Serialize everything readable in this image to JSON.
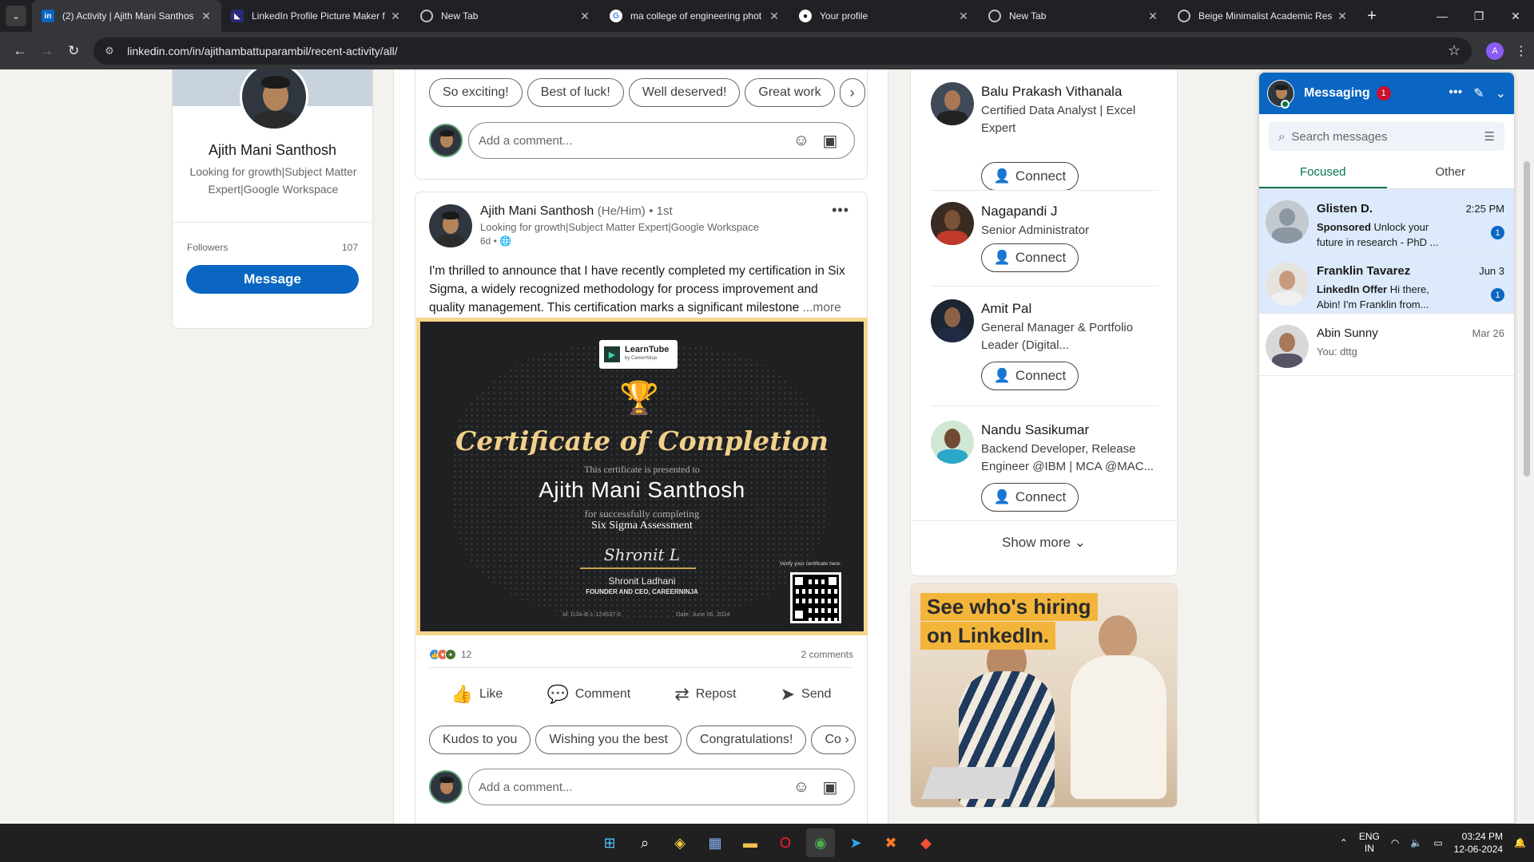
{
  "browser": {
    "tabs": [
      {
        "title": "(2) Activity | Ajith Mani Santhos",
        "favicon": "linkedin-icon",
        "active": true
      },
      {
        "title": "LinkedIn Profile Picture Maker f",
        "favicon": "pfp-maker-icon",
        "active": false
      },
      {
        "title": "New Tab",
        "favicon": "chrome-icon",
        "active": false
      },
      {
        "title": "ma college of engineering phot",
        "favicon": "google-icon",
        "active": false
      },
      {
        "title": "Your profile",
        "favicon": "github-icon",
        "active": false
      },
      {
        "title": "New Tab",
        "favicon": "chrome-icon",
        "active": false
      },
      {
        "title": "Beige Minimalist Academic Res",
        "favicon": "chrome-icon",
        "active": false
      }
    ],
    "url": "linkedin.com/in/ajithambattuparambil/recent-activity/all/",
    "profile_initial": "A"
  },
  "profile_card": {
    "name": "Ajith Mani Santhosh",
    "headline": "Looking for growth|Subject Matter Expert|Google Workspace",
    "followers_label": "Followers",
    "followers_count": "107",
    "message_button": "Message"
  },
  "post1": {
    "chips": [
      "So exciting!",
      "Best of luck!",
      "Well deserved!",
      "Great work"
    ],
    "comment_placeholder": "Add a comment..."
  },
  "post2": {
    "author": "Ajith Mani Santhosh",
    "pronouns": "(He/Him)",
    "degree": "• 1st",
    "headline": "Looking for growth|Subject Matter Expert|Google Workspace",
    "time": "6d •",
    "text": "I'm thrilled to announce that I have recently completed my certification in Six Sigma, a widely recognized methodology for process improvement and quality management. This certification marks a significant milestone",
    "more": "...more",
    "certificate": {
      "brand": "LearnTube",
      "brand_sub": "by CareerNinja",
      "title": "Certificate of Completion",
      "presented": "This certificate is presented to",
      "recipient": "Ajith Mani Santhosh",
      "for_text": "for successfully completing",
      "course": "Six Sigma Assessment",
      "signature": "Shronit L",
      "signer": "Shronit Ladhani",
      "signer_role": "FOUNDER AND CEO, CAREERNINJA",
      "id": "Id: DJA-B-1-124537-0",
      "date": "Date: June 06, 2024",
      "verify": "Verify your certificate here:"
    },
    "reaction_count": "12",
    "comments_count": "2 comments",
    "actions": {
      "like": "Like",
      "comment": "Comment",
      "repost": "Repost",
      "send": "Send"
    },
    "chips": [
      "Kudos to you",
      "Wishing you the best",
      "Congratulations!",
      "Co"
    ],
    "comment_placeholder": "Add a comment..."
  },
  "suggestions": [
    {
      "name": "Balu Prakash Vithanala",
      "headline": "Certified Data Analyst | Excel Expert",
      "button": "Connect"
    },
    {
      "name": "Nagapandi J",
      "headline": "Senior Administrator",
      "button": "Connect"
    },
    {
      "name": "Amit Pal",
      "headline": "General Manager & Portfolio Leader (Digital...",
      "button": "Connect"
    },
    {
      "name": "Nandu Sasikumar",
      "headline": "Backend Developer, Release Engineer @IBM | MCA @MAC...",
      "button": "Connect"
    }
  ],
  "show_more": "Show more",
  "ad": {
    "line1": "See who's hiring",
    "line2": "on LinkedIn."
  },
  "messaging": {
    "title": "Messaging",
    "badge": "1",
    "search_placeholder": "Search messages",
    "tabs": [
      "Focused",
      "Other"
    ],
    "conversations": [
      {
        "name": "Glisten D.",
        "date": "2:25 PM",
        "label": "Sponsored",
        "preview": "Unlock your future in research - PhD ...",
        "unread": "1"
      },
      {
        "name": "Franklin Tavarez",
        "date": "Jun 3",
        "label": "LinkedIn Offer",
        "preview": "Hi there, Abin! I'm Franklin from...",
        "unread": "1"
      },
      {
        "name": "Abin Sunny",
        "date": "Mar 26",
        "label": "",
        "preview": "You: dttg",
        "unread": ""
      }
    ]
  },
  "taskbar": {
    "lang1": "ENG",
    "lang2": "IN",
    "time": "03:24 PM",
    "date": "12-06-2024"
  },
  "colors": {
    "linkedin_blue": "#0a66c2",
    "focused_green": "#01754f",
    "cert_gold": "#f0d08a"
  }
}
